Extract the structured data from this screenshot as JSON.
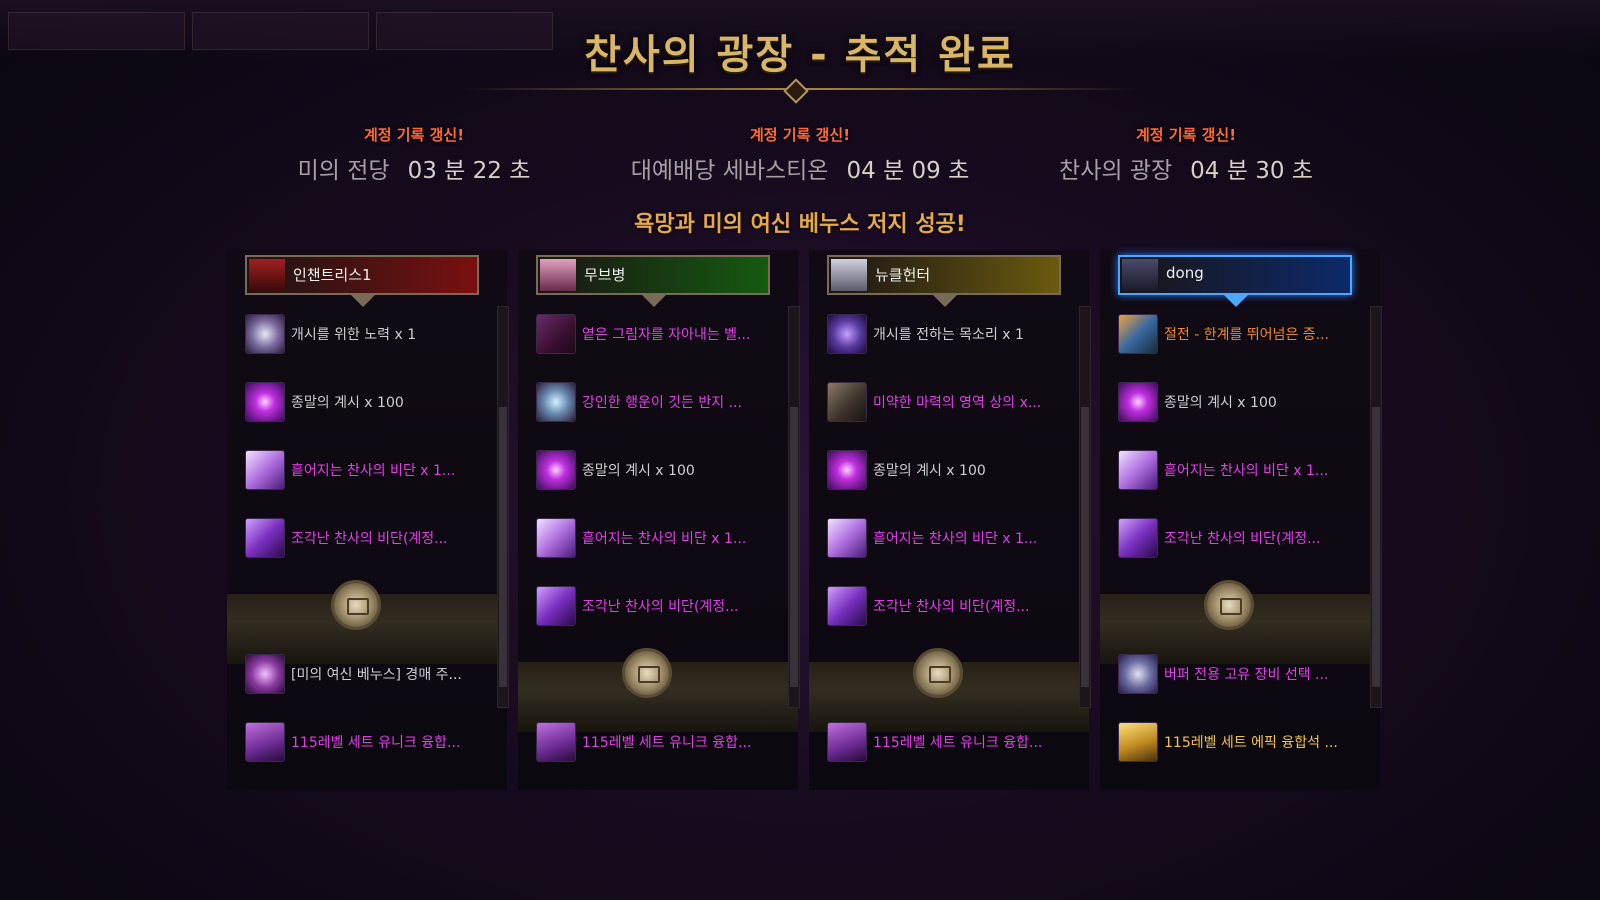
{
  "title": "찬사의 광장 - 추적 완료",
  "records": [
    {
      "tag": "계정 기록 갱신!",
      "dungeon": "미의 전당",
      "time": "03 분 22 초"
    },
    {
      "tag": "계정 기록 갱신!",
      "dungeon": "대예배당 세바스티온",
      "time": "04 분 09 초"
    },
    {
      "tag": "계정 기록 갱신!",
      "dungeon": "찬사의 광장",
      "time": "04 분 30 초"
    }
  ],
  "subtitle": "욕망과 미의 여신 베누스 저지 성공!",
  "players": [
    {
      "name": "인챈트리스1",
      "header_color": "#7a1010",
      "items": [
        {
          "text": "개시를 위한 노력 x 1",
          "grade": "white",
          "icon": "swirl-icon"
        },
        {
          "text": "종말의 계시 x 100",
          "grade": "white",
          "icon": "purple-orb-icon"
        },
        {
          "text": "흩어지는 찬사의 비단 x 1...",
          "grade": "pink",
          "icon": "silk-icon"
        },
        {
          "text": "조각난 찬사의 비단(계정...",
          "grade": "pink",
          "icon": "silk-shard-icon"
        },
        {
          "text": "[미의 여신 베누스] 경매 주...",
          "grade": "white",
          "icon": "venus-token-icon"
        },
        {
          "text": "115레벨 세트 유니크 융합...",
          "grade": "pink",
          "icon": "fusion-stone-icon"
        }
      ]
    },
    {
      "name": "무브병",
      "header_color": "#155a10",
      "items": [
        {
          "text": "옅은 그림자를 자아내는 벨...",
          "grade": "pink",
          "icon": "belt-icon"
        },
        {
          "text": "강인한 행운이 깃든 반지 ...",
          "grade": "pink",
          "icon": "ring-icon"
        },
        {
          "text": "종말의 계시 x 100",
          "grade": "white",
          "icon": "purple-orb-icon"
        },
        {
          "text": "흩어지는 찬사의 비단 x 1...",
          "grade": "pink",
          "icon": "silk-icon"
        },
        {
          "text": "조각난 찬사의 비단(계정...",
          "grade": "pink",
          "icon": "silk-shard-icon"
        },
        {
          "text": "115레벨 세트 유니크 융합...",
          "grade": "pink",
          "icon": "fusion-stone-icon"
        }
      ]
    },
    {
      "name": "뉴클헌터",
      "header_color": "#6a5a10",
      "items": [
        {
          "text": "개시를 전하는 목소리 x 1",
          "grade": "white",
          "icon": "voice-icon"
        },
        {
          "text": "미약한 마력의 영역 상의 x...",
          "grade": "pink",
          "icon": "armor-icon"
        },
        {
          "text": "종말의 계시 x 100",
          "grade": "white",
          "icon": "purple-orb-icon"
        },
        {
          "text": "흩어지는 찬사의 비단 x 1...",
          "grade": "pink",
          "icon": "silk-icon"
        },
        {
          "text": "조각난 찬사의 비단(계정...",
          "grade": "pink",
          "icon": "silk-shard-icon"
        },
        {
          "text": "115레벨 세트 유니크 융합...",
          "grade": "pink",
          "icon": "fusion-stone-icon"
        }
      ]
    },
    {
      "name": "dong",
      "header_color": "#0c2a6a",
      "items": [
        {
          "text": "절전 - 한계를 뛰어넘은 증...",
          "grade": "orange",
          "icon": "legendary-gem-icon"
        },
        {
          "text": "종말의 계시 x 100",
          "grade": "white",
          "icon": "purple-orb-icon"
        },
        {
          "text": "흩어지는 찬사의 비단 x 1...",
          "grade": "pink",
          "icon": "silk-icon"
        },
        {
          "text": "조각난 찬사의 비단(계정...",
          "grade": "pink",
          "icon": "silk-shard-icon"
        },
        {
          "text": "버퍼 전용 고유 장비 선택 ...",
          "grade": "pink",
          "icon": "buffer-box-icon"
        },
        {
          "text": "115레벨 세트 에픽 융합석 ...",
          "grade": "gold",
          "icon": "epic-fusion-icon"
        }
      ]
    }
  ]
}
